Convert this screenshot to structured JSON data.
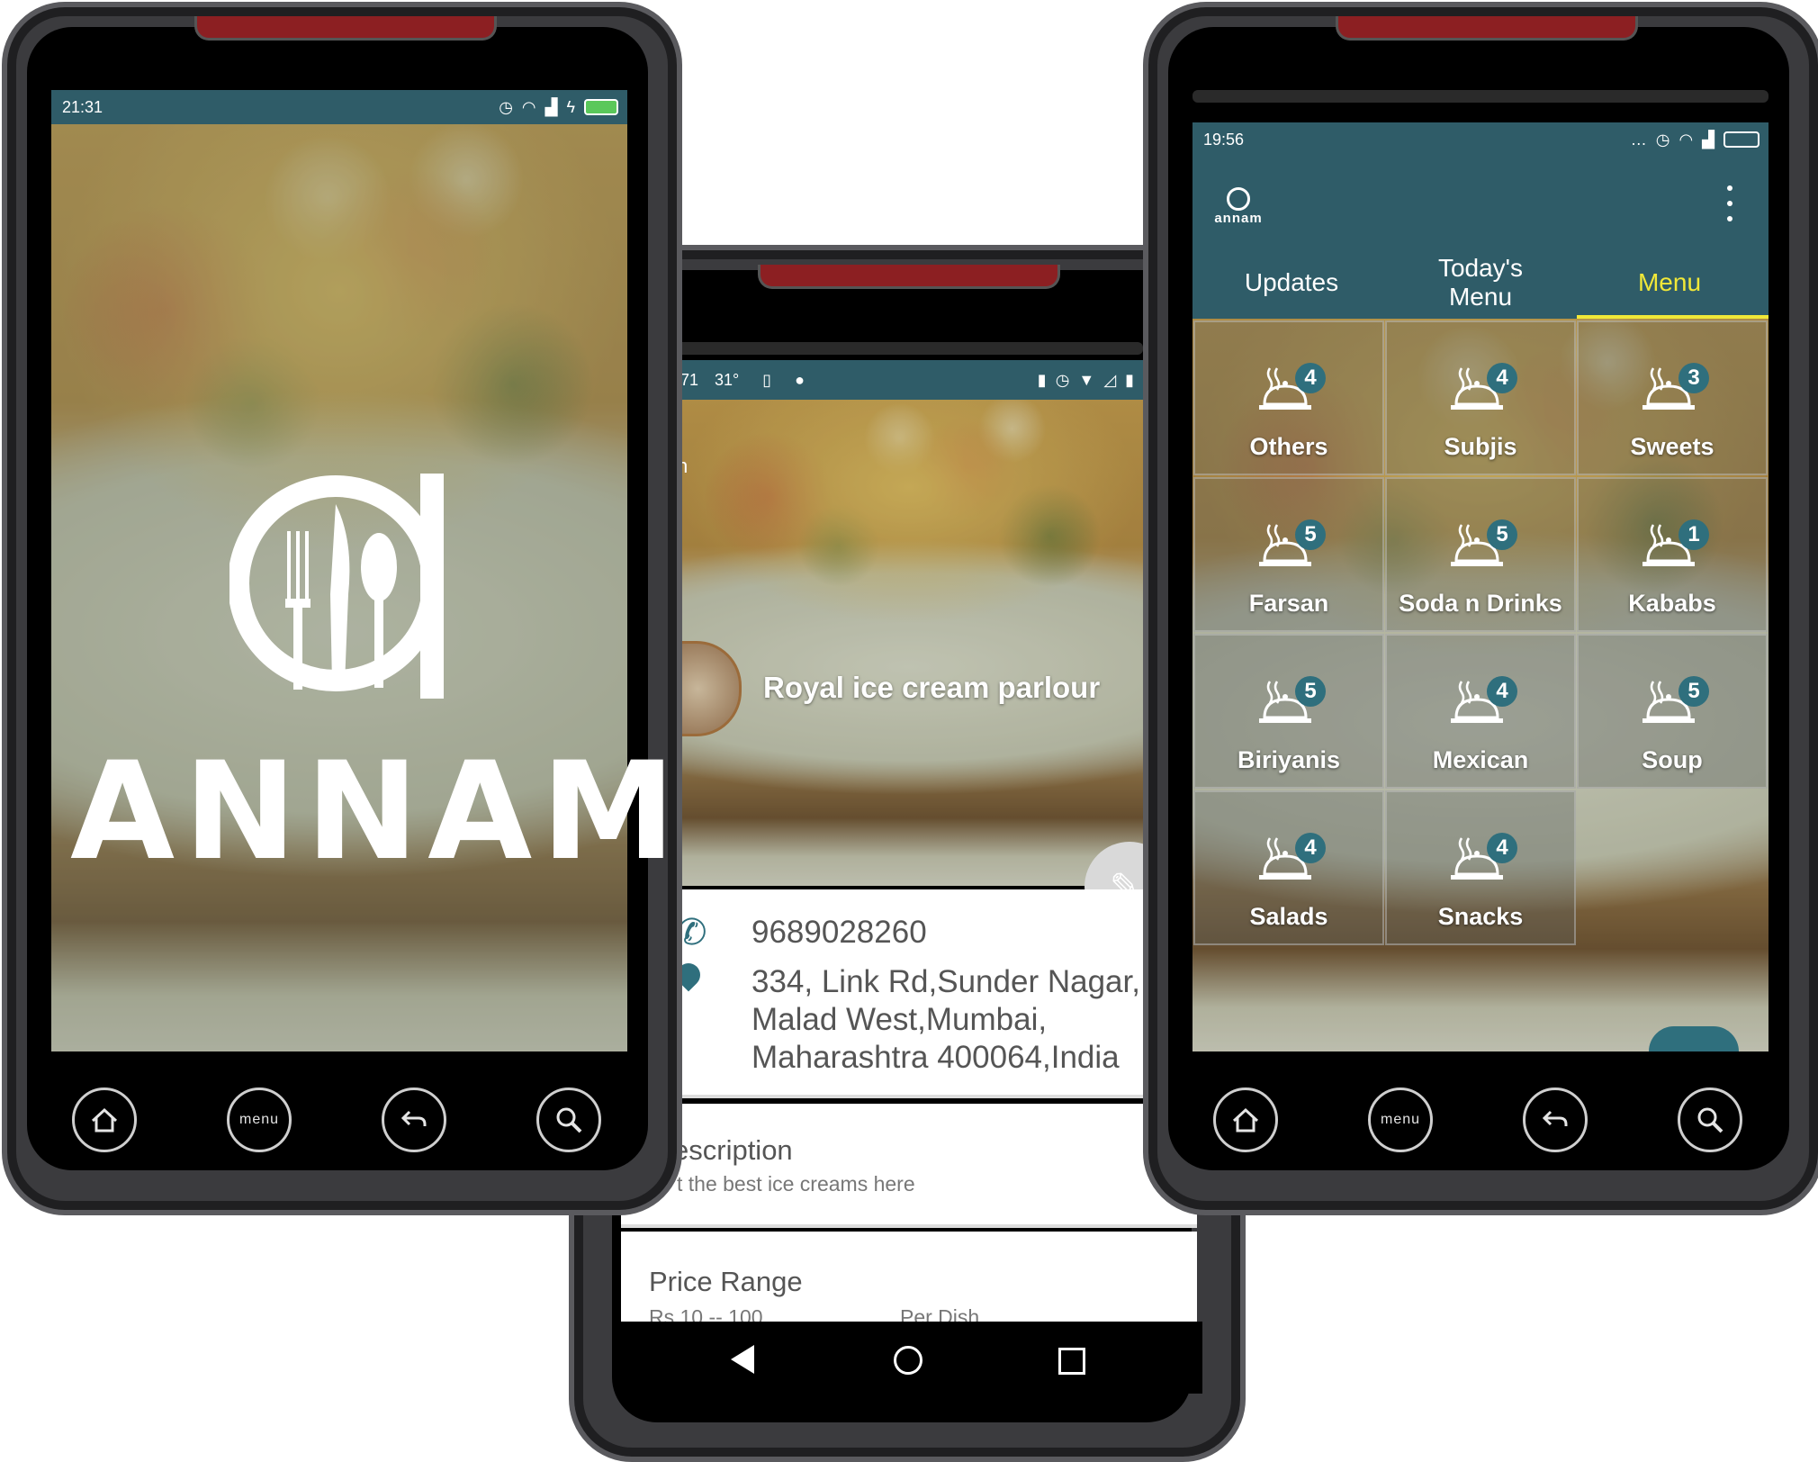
{
  "phones": {
    "left": {
      "status_time": "21:31",
      "brand": "ANNAM",
      "nav_menu_label": "menu"
    },
    "middle": {
      "status": {
        "time_prefix": "71",
        "temp": "31°"
      },
      "restaurant_name": "Royal ice cream parlour",
      "truncated_header": "n",
      "phone": "9689028260",
      "address_lines": [
        "334, Link Rd,Sunder Nagar,",
        "Malad West,Mumbai,",
        "Maharashtra 400064,India"
      ],
      "description_title": "escription",
      "description_text": "t the best ice creams here",
      "price_title": "Price Range",
      "price_value": "Rs 10 -- 100",
      "price_unit": "Per Dish"
    },
    "right": {
      "status_time": "19:56",
      "app_logo_text": "annam",
      "tabs": [
        "Updates",
        "Today's Menu",
        "Menu"
      ],
      "active_tab_index": 2,
      "active_tab_color": "#f1e838",
      "menu_items": [
        {
          "label": "Others",
          "count": "4"
        },
        {
          "label": "Subjis",
          "count": "4"
        },
        {
          "label": "Sweets",
          "count": "3"
        },
        {
          "label": "Farsan",
          "count": "5"
        },
        {
          "label": "Soda n Drinks",
          "count": "5"
        },
        {
          "label": "Kababs",
          "count": "1"
        },
        {
          "label": "Biriyanis",
          "count": "5"
        },
        {
          "label": "Mexican",
          "count": "4"
        },
        {
          "label": "Soup",
          "count": "5"
        },
        {
          "label": "Salads",
          "count": "4"
        },
        {
          "label": "Snacks",
          "count": "4"
        }
      ],
      "nav_menu_label": "menu"
    }
  },
  "colors": {
    "teal": "#2f5c68",
    "badge": "#2f6f7d",
    "accent_yellow": "#f1e838"
  }
}
